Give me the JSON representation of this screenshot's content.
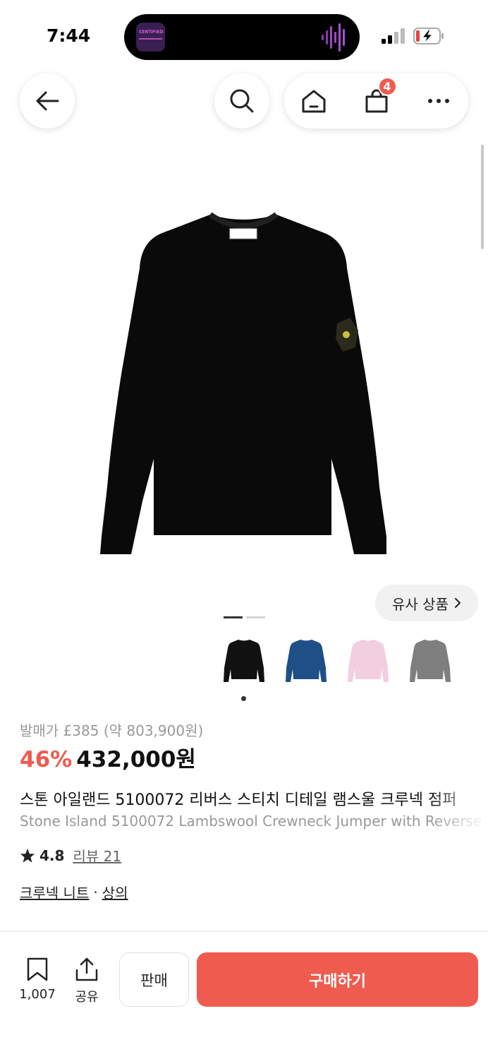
{
  "status_bar": {
    "time": "7:44",
    "now_playing_art_title": "CERTIFIED"
  },
  "nav": {
    "cart_count": "4",
    "icons": [
      "back-arrow-icon",
      "search-icon",
      "home-icon",
      "shopping-bag-icon",
      "more-icon"
    ]
  },
  "gallery": {
    "similar_label": "유사 상품",
    "page_count": 2,
    "active_page": 1,
    "thumbnails": [
      {
        "color_name": "black",
        "color": "#111111"
      },
      {
        "color_name": "navy blue",
        "color": "#1e4f86"
      },
      {
        "color_name": "pink",
        "color": "#f2cfe0"
      },
      {
        "color_name": "grey",
        "color": "#7e7e7e"
      }
    ],
    "selected_thumbnail": 0
  },
  "product": {
    "original_price": "발매가 £385 (약 803,900원)",
    "discount": "46%",
    "price": "432,000원",
    "title_ko": "스톤 아일랜드 5100072 리버스 스티치 디테일 램스울 크루넥 점퍼",
    "title_en": "Stone Island 5100072 Lambswool Crewneck Jumper with Reverse",
    "rating": "4.8",
    "review_label": "리뷰 21",
    "category_1": "크루넥 니트",
    "category_sep": "·",
    "category_2": "상의"
  },
  "bottom_bar": {
    "bookmark_count": "1,007",
    "share_label": "공유",
    "sell_label": "판매",
    "buy_label": "구매하기",
    "accent": "#ef5b4f"
  }
}
